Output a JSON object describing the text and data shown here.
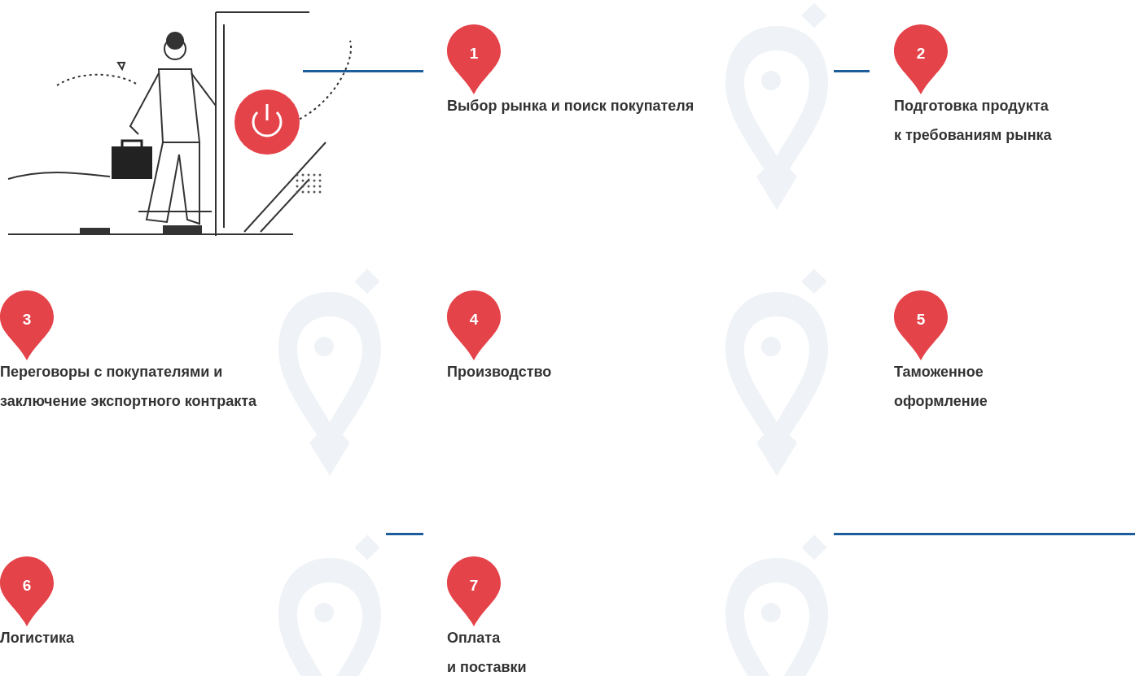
{
  "steps": [
    {
      "number": "1",
      "title": "Выбор рынка и поиск покупателя"
    },
    {
      "number": "2",
      "title": "Подготовка продукта\nк требованиям рынка"
    },
    {
      "number": "3",
      "title": "Переговоры с покупателями и\nзаключение экспортного контракта"
    },
    {
      "number": "4",
      "title": "Производство"
    },
    {
      "number": "5",
      "title": "Таможенное\nоформление"
    },
    {
      "number": "6",
      "title": "Логистика"
    },
    {
      "number": "7",
      "title": "Оплата\nи поставки"
    }
  ]
}
